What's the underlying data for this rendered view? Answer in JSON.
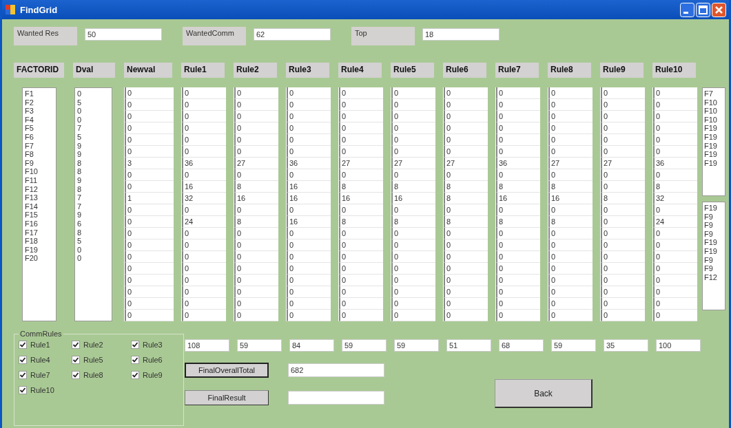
{
  "window": {
    "title": "FindGrid"
  },
  "params": [
    {
      "label": "Wanted Res",
      "value": "50"
    },
    {
      "label": "WantedComm",
      "value": "62"
    },
    {
      "label": "Top",
      "value": "18"
    }
  ],
  "columns": [
    {
      "header": "FACTORID",
      "kind": "list",
      "items": [
        "F1",
        "F2",
        "F3",
        "F4",
        "F5",
        "F6",
        "F7",
        "F8",
        "F9",
        "F10",
        "F11",
        "F12",
        "F13",
        "F14",
        "F15",
        "F16",
        "F17",
        "F18",
        "F19",
        "F20"
      ]
    },
    {
      "header": "Dval",
      "kind": "list",
      "items": [
        "0",
        "5",
        "0",
        "0",
        "7",
        "5",
        "9",
        "9",
        "8",
        "8",
        "9",
        "8",
        "7",
        "7",
        "9",
        "6",
        "8",
        "5",
        "0",
        "0"
      ]
    },
    {
      "header": "Newval",
      "kind": "grid",
      "cells": [
        "0",
        "0",
        "0",
        "0",
        "0",
        "0",
        "3",
        "0",
        "0",
        "1",
        "0",
        "0",
        "0",
        "0",
        "0",
        "0",
        "0",
        "0",
        "0",
        "0"
      ]
    },
    {
      "header": "Rule1",
      "kind": "grid",
      "cells": [
        "0",
        "0",
        "0",
        "0",
        "0",
        "0",
        "36",
        "0",
        "16",
        "32",
        "0",
        "24",
        "0",
        "0",
        "0",
        "0",
        "0",
        "0",
        "0",
        "0"
      ],
      "total": "108"
    },
    {
      "header": "Rule2",
      "kind": "grid",
      "cells": [
        "0",
        "0",
        "0",
        "0",
        "0",
        "0",
        "27",
        "0",
        "8",
        "16",
        "0",
        "8",
        "0",
        "0",
        "0",
        "0",
        "0",
        "0",
        "0",
        "0"
      ],
      "total": "59"
    },
    {
      "header": "Rule3",
      "kind": "grid",
      "cells": [
        "0",
        "0",
        "0",
        "0",
        "0",
        "0",
        "36",
        "0",
        "16",
        "16",
        "0",
        "16",
        "0",
        "0",
        "0",
        "0",
        "0",
        "0",
        "0",
        "0"
      ],
      "total": "84"
    },
    {
      "header": "Rule4",
      "kind": "grid",
      "cells": [
        "0",
        "0",
        "0",
        "0",
        "0",
        "0",
        "27",
        "0",
        "8",
        "16",
        "0",
        "8",
        "0",
        "0",
        "0",
        "0",
        "0",
        "0",
        "0",
        "0"
      ],
      "total": "59"
    },
    {
      "header": "Rule5",
      "kind": "grid",
      "cells": [
        "0",
        "0",
        "0",
        "0",
        "0",
        "0",
        "27",
        "0",
        "8",
        "16",
        "0",
        "8",
        "0",
        "0",
        "0",
        "0",
        "0",
        "0",
        "0",
        "0"
      ],
      "total": "59"
    },
    {
      "header": "Rule6",
      "kind": "grid",
      "cells": [
        "0",
        "0",
        "0",
        "0",
        "0",
        "0",
        "27",
        "0",
        "8",
        "8",
        "0",
        "8",
        "0",
        "0",
        "0",
        "0",
        "0",
        "0",
        "0",
        "0"
      ],
      "total": "51"
    },
    {
      "header": "Rule7",
      "kind": "grid",
      "cells": [
        "0",
        "0",
        "0",
        "0",
        "0",
        "0",
        "36",
        "0",
        "8",
        "16",
        "0",
        "8",
        "0",
        "0",
        "0",
        "0",
        "0",
        "0",
        "0",
        "0"
      ],
      "total": "68"
    },
    {
      "header": "Rule8",
      "kind": "grid",
      "cells": [
        "0",
        "0",
        "0",
        "0",
        "0",
        "0",
        "27",
        "0",
        "8",
        "16",
        "0",
        "8",
        "0",
        "0",
        "0",
        "0",
        "0",
        "0",
        "0",
        "0"
      ],
      "total": "59"
    },
    {
      "header": "Rule9",
      "kind": "grid",
      "cells": [
        "0",
        "0",
        "0",
        "0",
        "0",
        "0",
        "27",
        "0",
        "0",
        "8",
        "0",
        "0",
        "0",
        "0",
        "0",
        "0",
        "0",
        "0",
        "0",
        "0"
      ],
      "total": "35"
    },
    {
      "header": "Rule10",
      "kind": "grid",
      "cells": [
        "0",
        "0",
        "0",
        "0",
        "0",
        "0",
        "36",
        "0",
        "8",
        "32",
        "0",
        "24",
        "0",
        "0",
        "0",
        "0",
        "0",
        "0",
        "0",
        "0"
      ],
      "total": "100"
    }
  ],
  "result_lists": [
    {
      "items": [
        "F7",
        "F10",
        "F10",
        "F10",
        "F19",
        "F19",
        "F19",
        "F19",
        "F19"
      ]
    },
    {
      "items": [
        "F19",
        "F9",
        "F9",
        "F9",
        "F19",
        "F19",
        "F9",
        "F9",
        "F12"
      ]
    }
  ],
  "comm_rules": {
    "title": "CommRules",
    "rules": [
      {
        "label": "Rule1",
        "checked": true
      },
      {
        "label": "Rule2",
        "checked": true
      },
      {
        "label": "Rule3",
        "checked": true
      },
      {
        "label": "Rule4",
        "checked": true
      },
      {
        "label": "Rule5",
        "checked": true
      },
      {
        "label": "Rule6",
        "checked": true
      },
      {
        "label": "Rule7",
        "checked": true
      },
      {
        "label": "Rule8",
        "checked": true
      },
      {
        "label": "Rule9",
        "checked": true
      },
      {
        "label": "Rule10",
        "checked": true
      }
    ]
  },
  "final_overall_total": {
    "button": "FinalOverallTotal",
    "value": "682"
  },
  "final_result": {
    "button": "FinalResult"
  },
  "back_button": "Back"
}
